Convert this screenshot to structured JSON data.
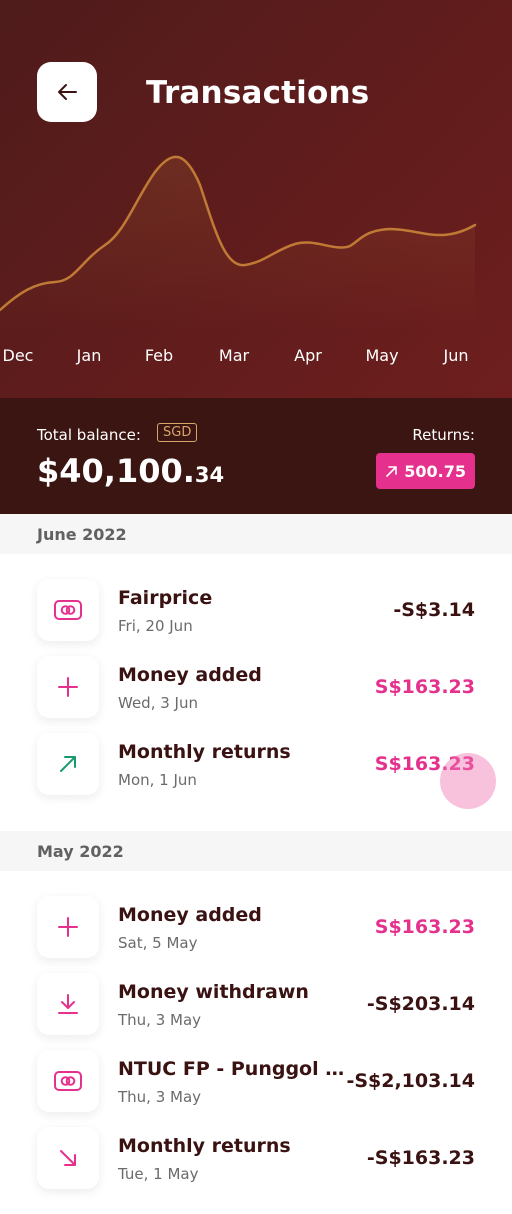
{
  "header": {
    "title": "Transactions",
    "back_icon": "arrow-left-icon"
  },
  "chart_data": {
    "type": "line",
    "categories": [
      "Dec",
      "Jan",
      "Feb",
      "Mar",
      "Apr",
      "May",
      "Jun"
    ],
    "series_color": "#c07a35"
  },
  "balance": {
    "label": "Total balance:",
    "currency": "SGD",
    "amount_int": "$40,100.",
    "amount_dec": "34",
    "returns_label": "Returns:",
    "returns_value": "500.75"
  },
  "sections": [
    {
      "title": "June 2022",
      "transactions": [
        {
          "name": "Fairprice",
          "date": "Fri, 20 Jun",
          "amount": "-S$3.14",
          "type": "negative",
          "icon": "card-icon"
        },
        {
          "name": "Money added",
          "date": "Wed, 3 Jun",
          "amount": "S$163.23",
          "type": "positive",
          "icon": "plus-icon"
        },
        {
          "name": "Monthly returns",
          "date": "Mon, 1 Jun",
          "amount": "S$163.23",
          "type": "positive",
          "icon": "arrow-up-right-icon"
        }
      ]
    },
    {
      "title": "May 2022",
      "transactions": [
        {
          "name": "Money added",
          "date": "Sat, 5 May",
          "amount": "S$163.23",
          "type": "positive",
          "icon": "plus-icon"
        },
        {
          "name": "Money withdrawn",
          "date": "Thu, 3 May",
          "amount": "-S$203.14",
          "type": "negative",
          "icon": "download-icon"
        },
        {
          "name": "NTUC FP - Punggol Oa...",
          "date": "Thu, 3 May",
          "amount": "-S$2,103.14",
          "type": "negative",
          "icon": "card-icon"
        },
        {
          "name": "Monthly returns",
          "date": "Tue, 1 May",
          "amount": "-S$163.23",
          "type": "negative",
          "icon": "arrow-down-right-icon"
        }
      ]
    }
  ],
  "colors": {
    "accent": "#e5318d",
    "dark": "#3a1212",
    "hero": "#5e1c1c",
    "green": "#1a9a6c"
  }
}
